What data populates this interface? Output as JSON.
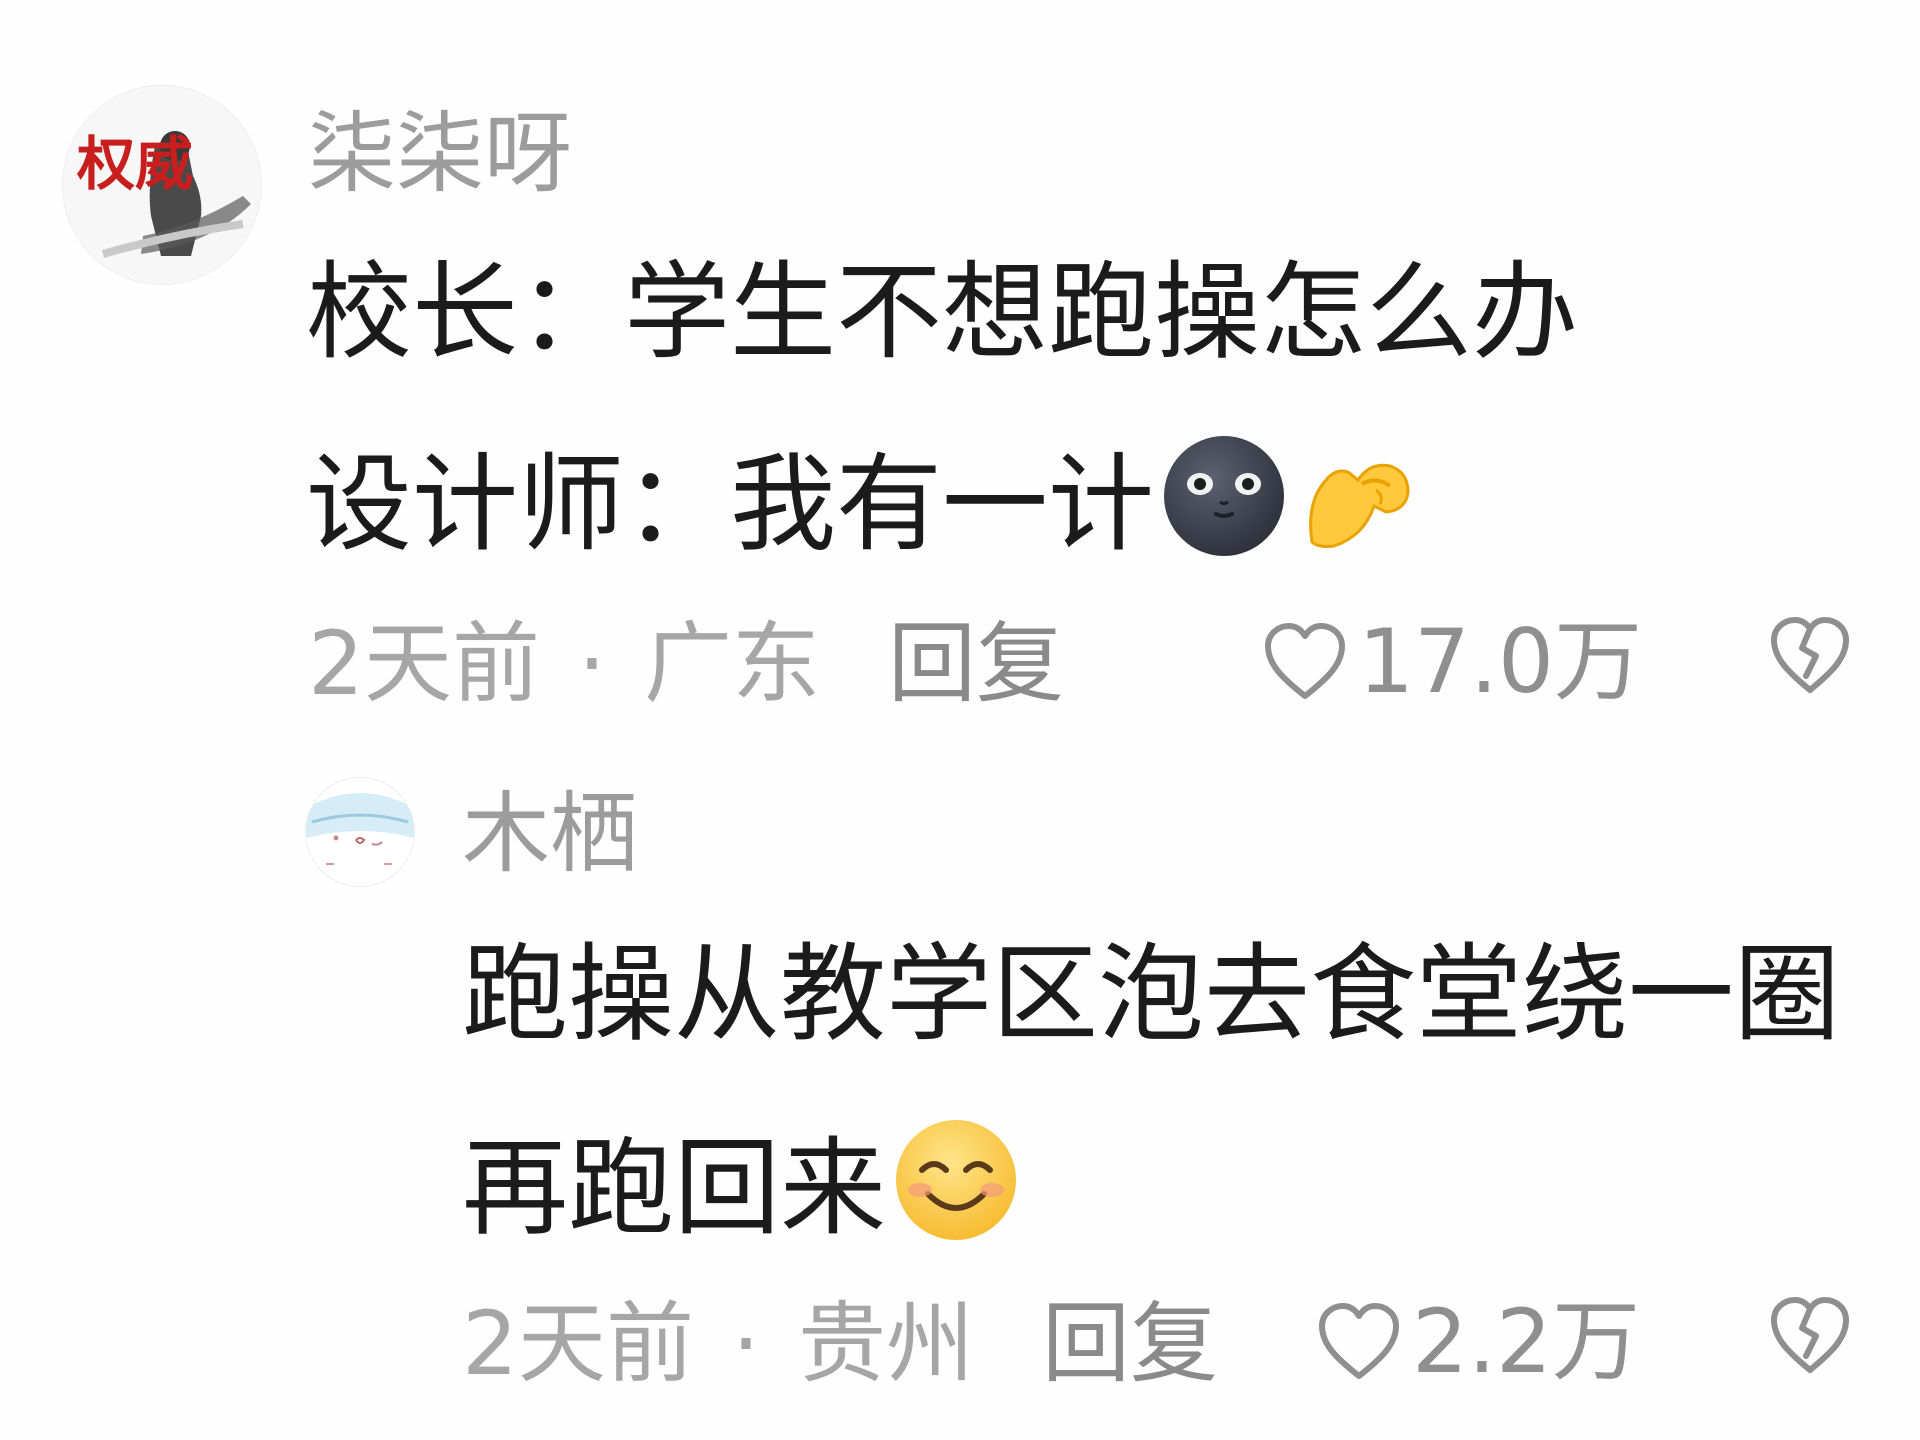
{
  "comments": [
    {
      "username": "柒柒呀",
      "avatar_text": "权威",
      "lines": [
        {
          "text": "校长：学生不想跑操怎么办",
          "emoji": []
        },
        {
          "text": "设计师：我有一计",
          "emoji": [
            "new-moon-face",
            "flexed-biceps"
          ]
        }
      ],
      "time": "2天前",
      "separator": "·",
      "location": "广东",
      "reply_label": "回复",
      "like_count": "17.0万",
      "icons": {
        "like": "heart-outline-icon",
        "dislike": "broken-heart-icon"
      }
    },
    {
      "username": "木栖",
      "lines": [
        {
          "text": "跑操从教学区泡去食堂绕一圈",
          "emoji": []
        },
        {
          "text": "再跑回来",
          "emoji": [
            "smiling-face-with-smiling-eyes"
          ]
        }
      ],
      "time": "2天前",
      "separator": "·",
      "location": "贵州",
      "reply_label": "回复",
      "like_count": "2.2万",
      "icons": {
        "like": "heart-outline-icon",
        "dislike": "broken-heart-icon"
      }
    }
  ],
  "colors": {
    "background": "#fefefe",
    "username": "#9c9c9c",
    "body_text": "#1b1b1b",
    "meta_text": "#a6a6a6",
    "action_gray": "#8a8a8a"
  }
}
